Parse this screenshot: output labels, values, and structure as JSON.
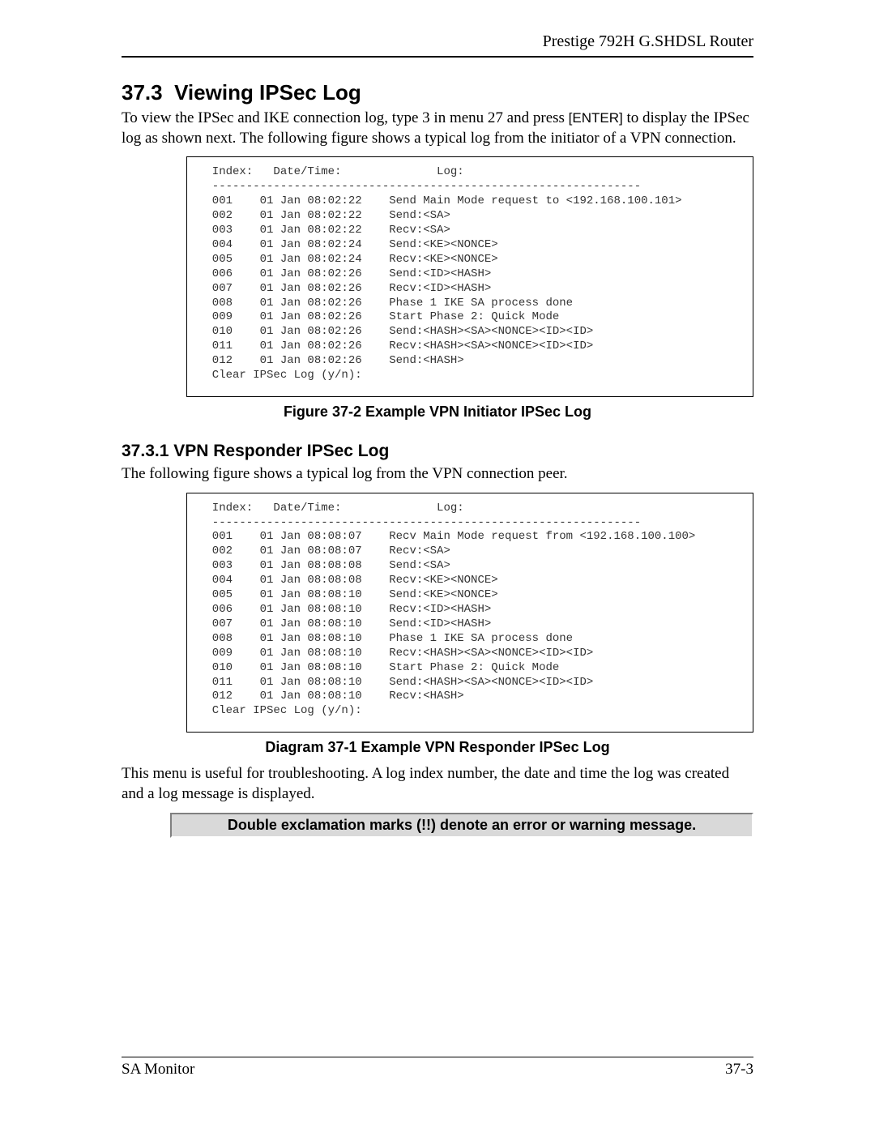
{
  "header": {
    "product": "Prestige 792H G.SHDSL Router"
  },
  "section": {
    "number": "37.3",
    "title": "Viewing IPSec Log",
    "intro_a": "To view the IPSec and IKE connection log, type 3 in menu 27 and press ",
    "enter": "[ENTER]",
    "intro_b": " to display the IPSec log as shown next.  The following figure shows a typical log from the initiator of a VPN connection."
  },
  "log1": {
    "header": "  Index:   Date/Time:              Log:",
    "divider": "  ---------------------------------------------------------------",
    "rows": [
      {
        "idx": "001",
        "dt": "01 Jan 08:02:22",
        "msg": "Send Main Mode request to <192.168.100.101>"
      },
      {
        "idx": "002",
        "dt": "01 Jan 08:02:22",
        "msg": "Send:<SA>"
      },
      {
        "idx": "003",
        "dt": "01 Jan 08:02:22",
        "msg": "Recv:<SA>"
      },
      {
        "idx": "004",
        "dt": "01 Jan 08:02:24",
        "msg": "Send:<KE><NONCE>"
      },
      {
        "idx": "005",
        "dt": "01 Jan 08:02:24",
        "msg": "Recv:<KE><NONCE>"
      },
      {
        "idx": "006",
        "dt": "01 Jan 08:02:26",
        "msg": "Send:<ID><HASH>"
      },
      {
        "idx": "007",
        "dt": "01 Jan 08:02:26",
        "msg": "Recv:<ID><HASH>"
      },
      {
        "idx": "008",
        "dt": "01 Jan 08:02:26",
        "msg": "Phase 1 IKE SA process done"
      },
      {
        "idx": "009",
        "dt": "01 Jan 08:02:26",
        "msg": "Start Phase 2: Quick Mode"
      },
      {
        "idx": "010",
        "dt": "01 Jan 08:02:26",
        "msg": "Send:<HASH><SA><NONCE><ID><ID>"
      },
      {
        "idx": "011",
        "dt": "01 Jan 08:02:26",
        "msg": "Recv:<HASH><SA><NONCE><ID><ID>"
      },
      {
        "idx": "012",
        "dt": "01 Jan 08:02:26",
        "msg": "Send:<HASH>"
      }
    ],
    "prompt": "  Clear IPSec Log (y/n):"
  },
  "caption1": "Figure 37-2 Example VPN Initiator IPSec Log",
  "sub": {
    "number": "37.3.1",
    "title": "VPN Responder IPSec Log",
    "intro": "The following figure shows a typical log from the VPN connection peer."
  },
  "log2": {
    "header": "  Index:   Date/Time:              Log:",
    "divider": "  ---------------------------------------------------------------",
    "rows": [
      {
        "idx": "001",
        "dt": "01 Jan 08:08:07",
        "msg": "Recv Main Mode request from <192.168.100.100>"
      },
      {
        "idx": "002",
        "dt": "01 Jan 08:08:07",
        "msg": "Recv:<SA>"
      },
      {
        "idx": "003",
        "dt": "01 Jan 08:08:08",
        "msg": "Send:<SA>"
      },
      {
        "idx": "004",
        "dt": "01 Jan 08:08:08",
        "msg": "Recv:<KE><NONCE>"
      },
      {
        "idx": "005",
        "dt": "01 Jan 08:08:10",
        "msg": "Send:<KE><NONCE>"
      },
      {
        "idx": "006",
        "dt": "01 Jan 08:08:10",
        "msg": "Recv:<ID><HASH>"
      },
      {
        "idx": "007",
        "dt": "01 Jan 08:08:10",
        "msg": "Send:<ID><HASH>"
      },
      {
        "idx": "008",
        "dt": "01 Jan 08:08:10",
        "msg": "Phase 1 IKE SA process done"
      },
      {
        "idx": "009",
        "dt": "01 Jan 08:08:10",
        "msg": "Recv:<HASH><SA><NONCE><ID><ID>"
      },
      {
        "idx": "010",
        "dt": "01 Jan 08:08:10",
        "msg": "Start Phase 2: Quick Mode"
      },
      {
        "idx": "011",
        "dt": "01 Jan 08:08:10",
        "msg": "Send:<HASH><SA><NONCE><ID><ID>"
      },
      {
        "idx": "012",
        "dt": "01 Jan 08:08:10",
        "msg": "Recv:<HASH>"
      }
    ],
    "prompt": "  Clear IPSec Log (y/n):"
  },
  "caption2": "Diagram 37-1 Example VPN Responder IPSec Log",
  "after_log2": "This menu is useful for troubleshooting. A log index number, the date and time the log was created and a log message is displayed.",
  "note": "Double exclamation marks (!!) denote an error or warning message.",
  "footer": {
    "left": "SA Monitor",
    "right": "37-3"
  }
}
